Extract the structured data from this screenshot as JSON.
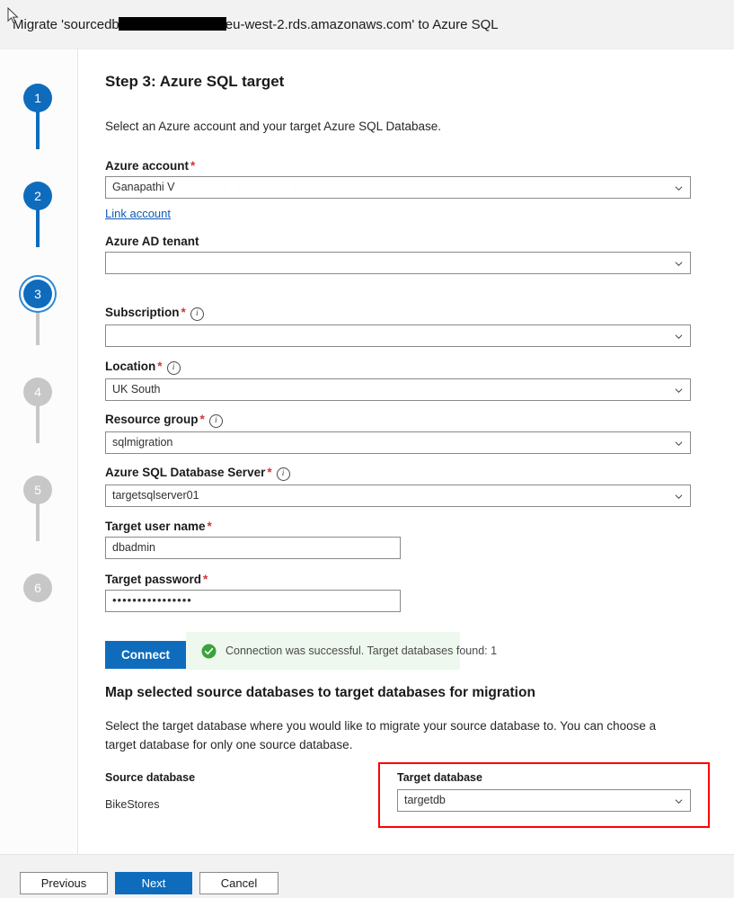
{
  "window": {
    "title_prefix": "Migrate 'sourcedb",
    "title_suffix": "eu-west-2.rds.amazonaws.com' to Azure SQL",
    "redacted": true
  },
  "stepper": {
    "steps": [
      {
        "number": "1",
        "state": "done"
      },
      {
        "number": "2",
        "state": "done"
      },
      {
        "number": "3",
        "state": "current"
      },
      {
        "number": "4",
        "state": "inactive"
      },
      {
        "number": "5",
        "state": "inactive"
      },
      {
        "number": "6",
        "state": "inactive"
      }
    ],
    "active_color": "#0f6cbd",
    "inactive_color": "#c7c7c7"
  },
  "page": {
    "heading": "Step 3: Azure SQL target",
    "lead": "Select an Azure account and your target Azure SQL Database."
  },
  "fields": {
    "azure_account": {
      "label": "Azure account",
      "required": true,
      "has_info": false,
      "value": "Ganapathi V",
      "type": "dropdown"
    },
    "link_account": {
      "label": "Link account"
    },
    "azure_ad_tenant": {
      "label": "Azure AD tenant",
      "required": false,
      "has_info": false,
      "value": "",
      "type": "dropdown"
    },
    "subscription": {
      "label": "Subscription",
      "required": true,
      "has_info": true,
      "value": "",
      "type": "dropdown"
    },
    "location": {
      "label": "Location",
      "required": true,
      "has_info": true,
      "value": "UK South",
      "type": "dropdown"
    },
    "resource_group": {
      "label": "Resource group",
      "required": true,
      "has_info": true,
      "value": "sqlmigration",
      "type": "dropdown"
    },
    "sql_server": {
      "label": "Azure SQL Database Server",
      "required": true,
      "has_info": true,
      "value": "targetsqlserver01",
      "type": "dropdown"
    },
    "target_user_name": {
      "label": "Target user name",
      "required": true,
      "has_info": false,
      "value": "dbadmin",
      "type": "text"
    },
    "target_password": {
      "label": "Target password",
      "required": true,
      "has_info": false,
      "value": "••••••••••••••••",
      "type": "password"
    }
  },
  "connect": {
    "button_label": "Connect",
    "status_text": "Connection was successful. Target databases found: 1",
    "status_kind": "success",
    "success_bg": "#eef8ee",
    "success_color": "#3aa33a"
  },
  "mapping": {
    "heading": "Map selected source databases to target databases for migration",
    "description": "Select the target database where you would like to migrate your source database to. You can choose a target database for only one source database.",
    "source_column_label": "Source database",
    "target_column_label": "Target database",
    "rows": [
      {
        "source": "BikeStores",
        "target": "targetdb"
      }
    ],
    "highlight_color": "#ff0000"
  },
  "footer": {
    "previous_label": "Previous",
    "next_label": "Next",
    "cancel_label": "Cancel",
    "primary_color": "#0f6cbd"
  },
  "icons": {
    "info": "i",
    "chevron_down": "chevron-down-icon",
    "check": "check-icon",
    "cursor": "mouse-cursor"
  }
}
